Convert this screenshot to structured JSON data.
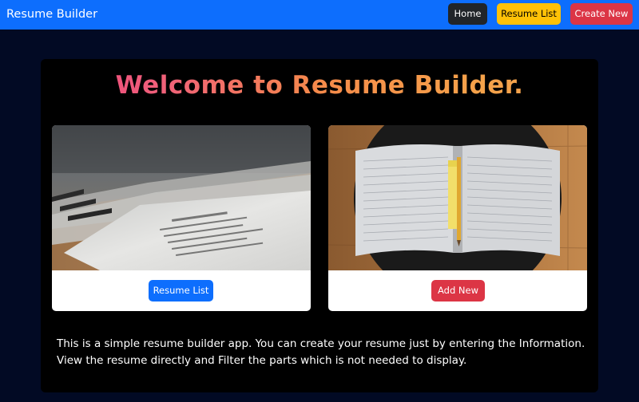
{
  "navbar": {
    "brand": "Resume Builder",
    "home_label": "Home",
    "resume_list_label": "Resume List",
    "create_new_label": "Create New"
  },
  "main": {
    "headline": "Welcome to Resume Builder.",
    "cards": [
      {
        "image": "resume-papers-photo",
        "button_label": "Resume List"
      },
      {
        "image": "open-notebook-photo",
        "button_label": "Add New"
      }
    ],
    "description": "This is a simple resume builder app. You can create your resume just by entering the Information. View the resume directly and Filter the parts which is not needed to display."
  },
  "colors": {
    "navbar": "#0d6efd",
    "background": "#020a24",
    "panel": "#000000",
    "home_button": "#212529",
    "list_button": "#ffc107",
    "create_button": "#dc3545",
    "headline_gradient_start": "#e8347e",
    "headline_gradient_end": "#f0a050"
  }
}
